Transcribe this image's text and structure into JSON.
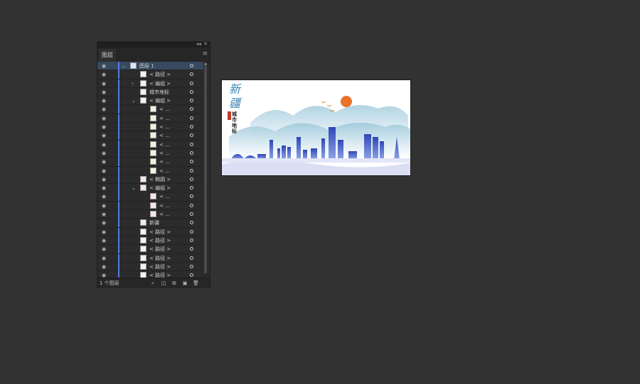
{
  "panel": {
    "tab_label": "图层",
    "layer_count_label": "1 个图层",
    "rows": [
      {
        "name": "图层 1",
        "arrow": "⌄",
        "thumb": "t-sel",
        "selected": true,
        "level": 0
      },
      {
        "name": "< 路径 >",
        "arrow": "",
        "thumb": "",
        "selected": false,
        "level": 1
      },
      {
        "name": "< 编组 >",
        "arrow": "›",
        "thumb": "",
        "selected": false,
        "level": 1
      },
      {
        "name": "城市地标",
        "arrow": "",
        "thumb": "t-lm",
        "selected": false,
        "level": 1
      },
      {
        "name": "< 编组 >",
        "arrow": "⌄",
        "thumb": "",
        "selected": false,
        "level": 1
      },
      {
        "name": "< ...",
        "arrow": "",
        "thumb": "t-y",
        "selected": false,
        "level": 2
      },
      {
        "name": "< ...",
        "arrow": "",
        "thumb": "t-y",
        "selected": false,
        "level": 2
      },
      {
        "name": "< ...",
        "arrow": "",
        "thumb": "t-y",
        "selected": false,
        "level": 2
      },
      {
        "name": "< ...",
        "arrow": "",
        "thumb": "t-y",
        "selected": false,
        "level": 2
      },
      {
        "name": "< ...",
        "arrow": "",
        "thumb": "t-y",
        "selected": false,
        "level": 2
      },
      {
        "name": "< ...",
        "arrow": "",
        "thumb": "t-y",
        "selected": false,
        "level": 2
      },
      {
        "name": "< ...",
        "arrow": "",
        "thumb": "t-y",
        "selected": false,
        "level": 2
      },
      {
        "name": "< ...",
        "arrow": "",
        "thumb": "t-y",
        "selected": false,
        "level": 2
      },
      {
        "name": "< 椭圆 >",
        "arrow": "",
        "thumb": "t-r",
        "selected": false,
        "level": 1
      },
      {
        "name": "< 编组 >",
        "arrow": "⌄",
        "thumb": "t-r",
        "selected": false,
        "level": 1
      },
      {
        "name": "< ...",
        "arrow": "",
        "thumb": "t-r",
        "selected": false,
        "level": 2
      },
      {
        "name": "< ...",
        "arrow": "",
        "thumb": "t-r",
        "selected": false,
        "level": 2
      },
      {
        "name": "< ...",
        "arrow": "",
        "thumb": "t-r",
        "selected": false,
        "level": 2
      },
      {
        "name": "新疆",
        "arrow": "",
        "thumb": "t-nj",
        "selected": false,
        "level": 1
      },
      {
        "name": "< 路径 >",
        "arrow": "",
        "thumb": "",
        "selected": false,
        "level": 1
      },
      {
        "name": "< 路径 >",
        "arrow": "",
        "thumb": "",
        "selected": false,
        "level": 1
      },
      {
        "name": "< 路径 >",
        "arrow": "",
        "thumb": "",
        "selected": false,
        "level": 1
      },
      {
        "name": "< 路径 >",
        "arrow": "",
        "thumb": "",
        "selected": false,
        "level": 1
      },
      {
        "name": "< 路径 >",
        "arrow": "",
        "thumb": "",
        "selected": false,
        "level": 1
      },
      {
        "name": "< 路径 >",
        "arrow": "",
        "thumb": "",
        "selected": false,
        "level": 1
      }
    ]
  },
  "artboard": {
    "title": "新疆",
    "subtitle": "城市地标"
  },
  "colors": {
    "mountain": "#a9cfe0",
    "skyline": "#3b55c4",
    "sun": "#e8742a",
    "selection": "#36495e",
    "layer_color": "#4f7de0"
  }
}
